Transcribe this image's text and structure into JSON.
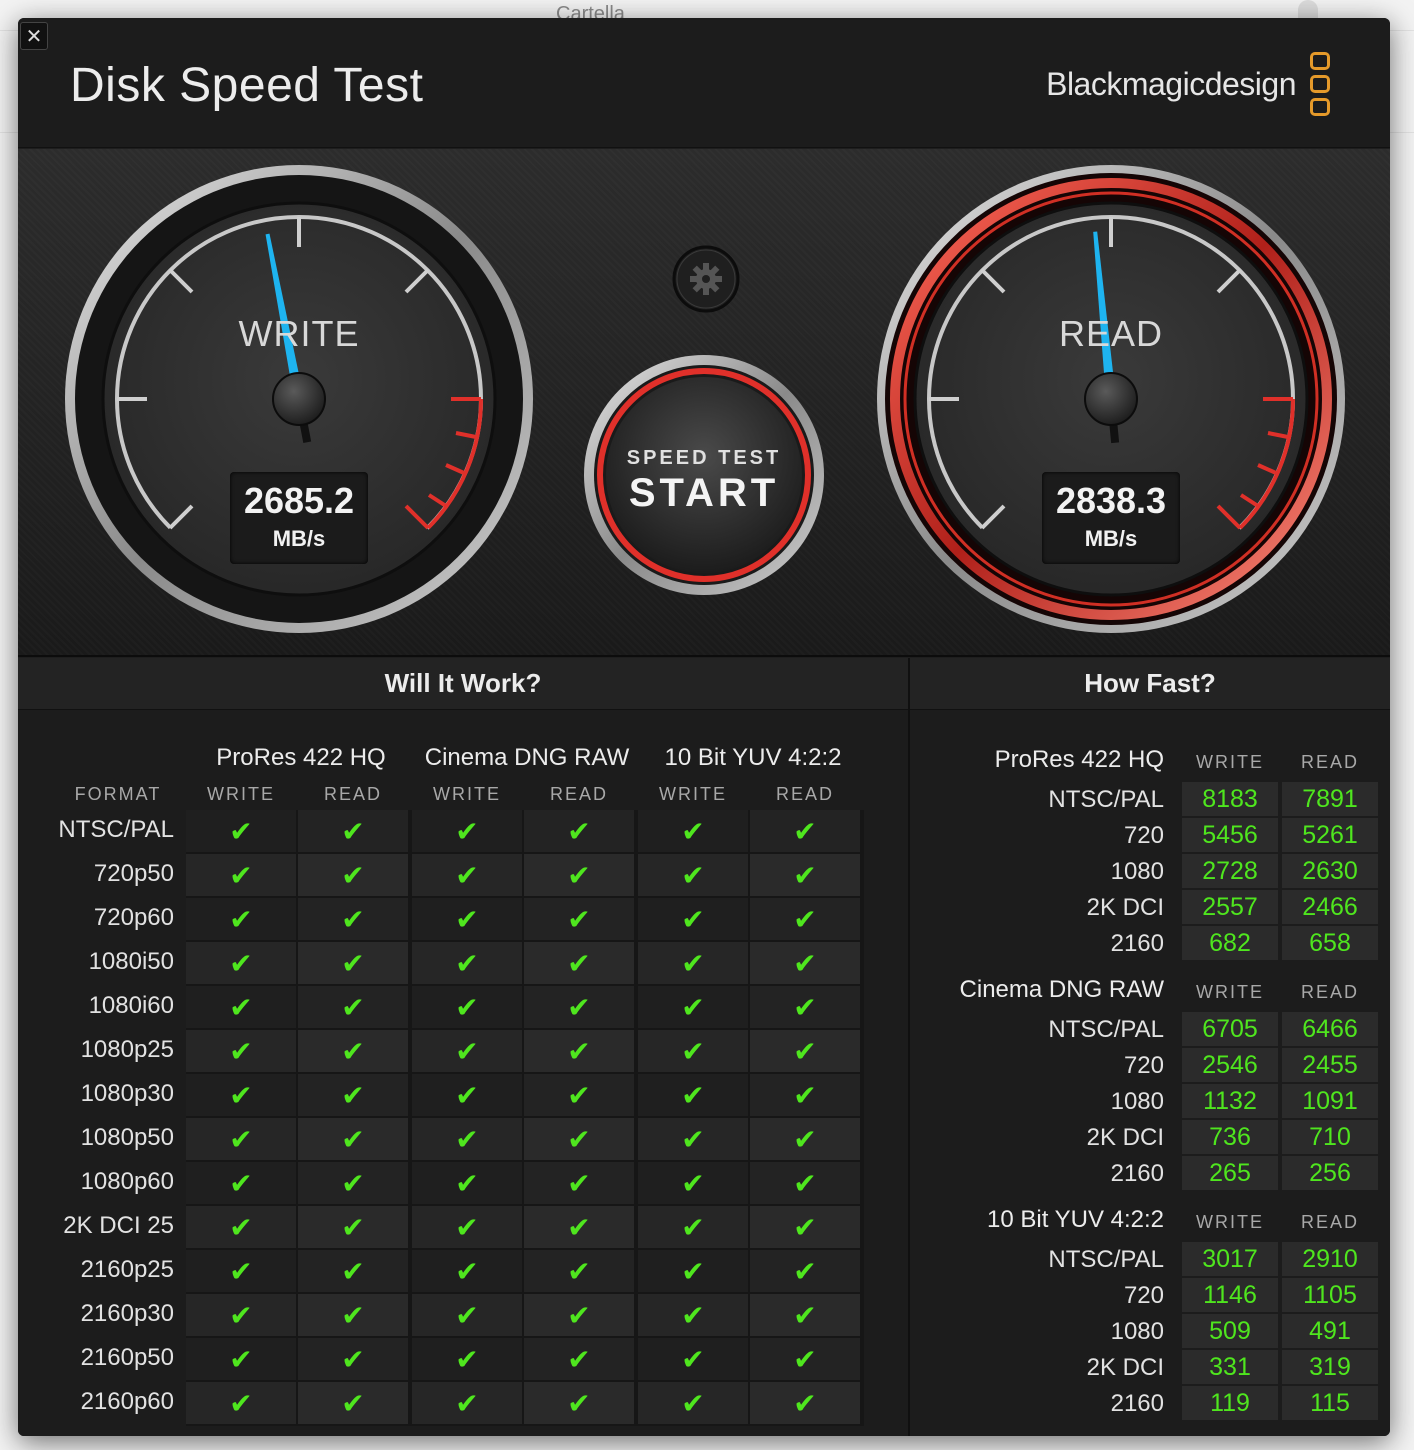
{
  "background": {
    "window_title": "Cartella"
  },
  "app": {
    "title": "Disk Speed Test",
    "brand": "Blackmagicdesign",
    "close_label": "✕"
  },
  "gauges": {
    "write": {
      "label": "WRITE",
      "value": "2685.2",
      "unit": "MB/s",
      "needle_fraction": 0.46
    },
    "read": {
      "label": "READ",
      "value": "2838.3",
      "unit": "MB/s",
      "needle_fraction": 0.48
    }
  },
  "start_button": {
    "line1": "SPEED TEST",
    "line2": "START"
  },
  "settings_icon": "gear-icon",
  "will_it_work": {
    "title": "Will It Work?",
    "format_header": "FORMAT",
    "codecs": [
      "ProRes 422 HQ",
      "Cinema DNG RAW",
      "10 Bit YUV 4:2:2"
    ],
    "columns": [
      "WRITE",
      "READ",
      "WRITE",
      "READ",
      "WRITE",
      "READ"
    ],
    "formats": [
      "NTSC/PAL",
      "720p50",
      "720p60",
      "1080i50",
      "1080i60",
      "1080p25",
      "1080p30",
      "1080p50",
      "1080p60",
      "2K DCI 25",
      "2160p25",
      "2160p30",
      "2160p50",
      "2160p60"
    ],
    "check_glyph": "✔"
  },
  "how_fast": {
    "title": "How Fast?",
    "write_header": "WRITE",
    "read_header": "READ",
    "groups": [
      {
        "codec": "ProRes 422 HQ",
        "rows": [
          {
            "label": "NTSC/PAL",
            "write": "8183",
            "read": "7891"
          },
          {
            "label": "720",
            "write": "5456",
            "read": "5261"
          },
          {
            "label": "1080",
            "write": "2728",
            "read": "2630"
          },
          {
            "label": "2K DCI",
            "write": "2557",
            "read": "2466"
          },
          {
            "label": "2160",
            "write": "682",
            "read": "658"
          }
        ]
      },
      {
        "codec": "Cinema DNG RAW",
        "rows": [
          {
            "label": "NTSC/PAL",
            "write": "6705",
            "read": "6466"
          },
          {
            "label": "720",
            "write": "2546",
            "read": "2455"
          },
          {
            "label": "1080",
            "write": "1132",
            "read": "1091"
          },
          {
            "label": "2K DCI",
            "write": "736",
            "read": "710"
          },
          {
            "label": "2160",
            "write": "265",
            "read": "256"
          }
        ]
      },
      {
        "codec": "10 Bit YUV 4:2:2",
        "rows": [
          {
            "label": "NTSC/PAL",
            "write": "3017",
            "read": "2910"
          },
          {
            "label": "720",
            "write": "1146",
            "read": "1105"
          },
          {
            "label": "1080",
            "write": "509",
            "read": "491"
          },
          {
            "label": "2K DCI",
            "write": "331",
            "read": "319"
          },
          {
            "label": "2160",
            "write": "119",
            "read": "115"
          }
        ]
      }
    ]
  },
  "colors": {
    "accent_green": "#4fe61e",
    "needle_blue": "#1eb4f0",
    "red_zone": "#e0302a",
    "brand_orange": "#e59a2a"
  }
}
